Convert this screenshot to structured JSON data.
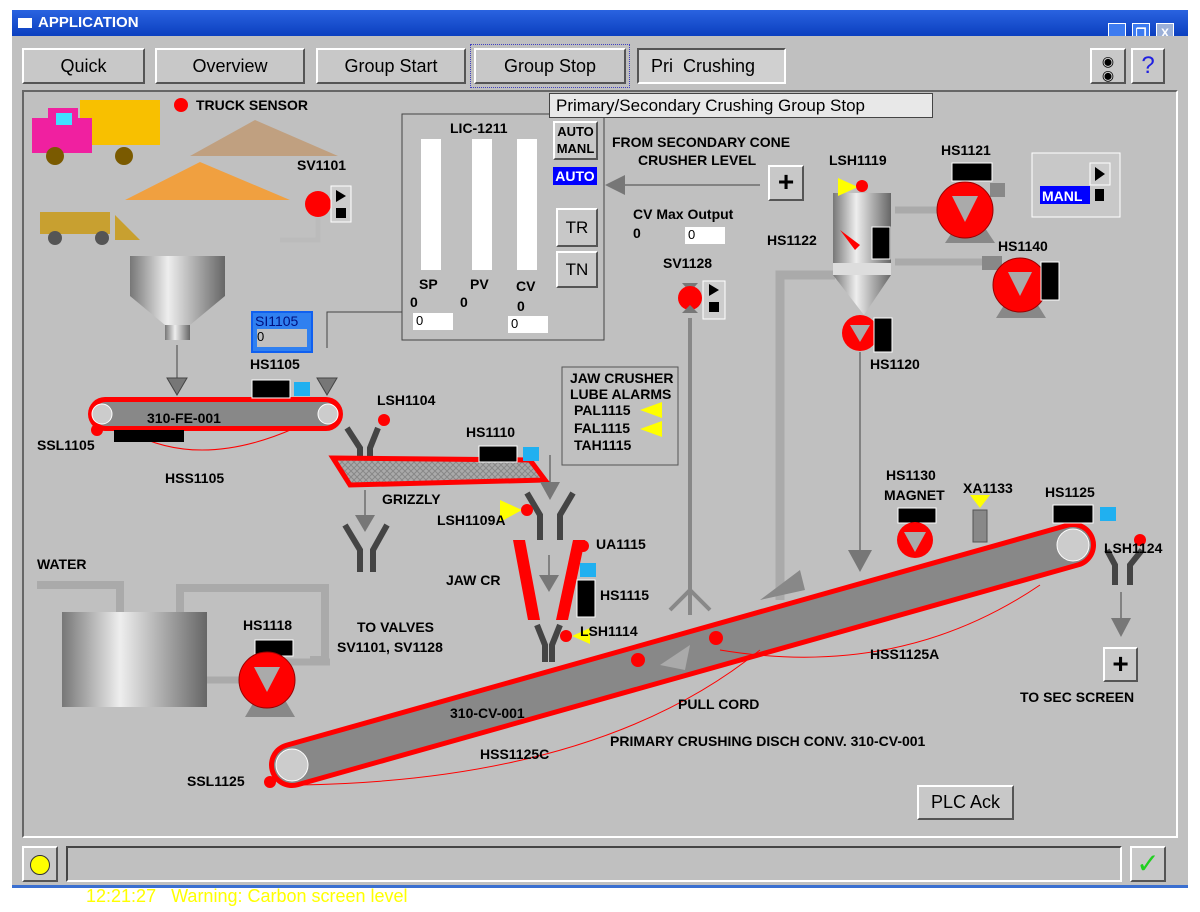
{
  "window": {
    "title": "APPLICATION",
    "minimize": "_",
    "restore": "❐",
    "close": "X"
  },
  "toolbar": {
    "buttons": [
      "Quick",
      "Overview",
      "Group Start",
      "Group Stop",
      "Pri  Crushing"
    ],
    "help": "?",
    "settings_icon": "sliders-icon"
  },
  "tooltip": "Primary/Secondary Crushing Group Stop",
  "controller": {
    "tag": "LIC-1211",
    "auto_manl": [
      "AUTO",
      "MANL"
    ],
    "mode": "AUTO",
    "tr": "TR",
    "tn": "TN",
    "bars": [
      "SP",
      "PV",
      "CV"
    ],
    "values": [
      "0",
      "0",
      "0"
    ],
    "inputs": [
      "0",
      "0"
    ],
    "from_label_1": "FROM SECONDARY CONE",
    "from_label_2": "CRUSHER LEVEL",
    "cv_max_label": "CV Max Output",
    "cv_max_value": "0",
    "cv_max_input": "0"
  },
  "manl_box": {
    "mode": "MANL"
  },
  "si1105": {
    "tag": "SI1105",
    "value": "0"
  },
  "lube": {
    "title1": "JAW CRUSHER",
    "title2": "LUBE ALARMS",
    "items": [
      "PAL1115",
      "FAL1115",
      "TAH1115"
    ]
  },
  "labels": {
    "truck_sensor": "TRUCK SENSOR",
    "sv1101": "SV1101",
    "sv1128": "SV1128",
    "lsh1119": "LSH1119",
    "hs1121": "HS1121",
    "hs1122": "HS1122",
    "hs1140": "HS1140",
    "hs1120": "HS1120",
    "hs1105": "HS1105",
    "fe": "310-FE-001",
    "ssl1105": "SSL1105",
    "hss1105": "HSS1105",
    "lsh1104": "LSH1104",
    "hs1110": "HS1110",
    "grizzly": "GRIZZLY",
    "lsh1109a": "LSH1109A",
    "ua1115": "UA1115",
    "jawcr": "JAW CR",
    "hs1115": "HS1115",
    "lsh1114": "LSH1114",
    "water": "WATER",
    "hs1118": "HS1118",
    "to_valves": "TO VALVES",
    "to_valves2": "SV1101, SV1128",
    "hs1130": "HS1130",
    "magnet": "MAGNET",
    "xa1133": "XA1133",
    "hs1125": "HS1125",
    "lsh1124": "LSH1124",
    "hss1125a": "HSS1125A",
    "to_sec": "TO SEC SCREEN",
    "pull_cord": "PULL CORD",
    "cv": "310-CV-001",
    "disch": "PRIMARY CRUSHING DISCH CONV. 310-CV-001",
    "hss1125c": "HSS1125C",
    "ssl1125": "SSL1125"
  },
  "plc_ack": "PLC Ack",
  "status": {
    "time": "12:21:27",
    "message": "Warning: Carbon screen level",
    "ack_icon": "checkmark-icon"
  },
  "colors": {
    "alarm_red": "#ff0000",
    "warning_yellow": "#ffff00",
    "mode_blue": "#0000ff",
    "status_text": "#ffff00"
  }
}
